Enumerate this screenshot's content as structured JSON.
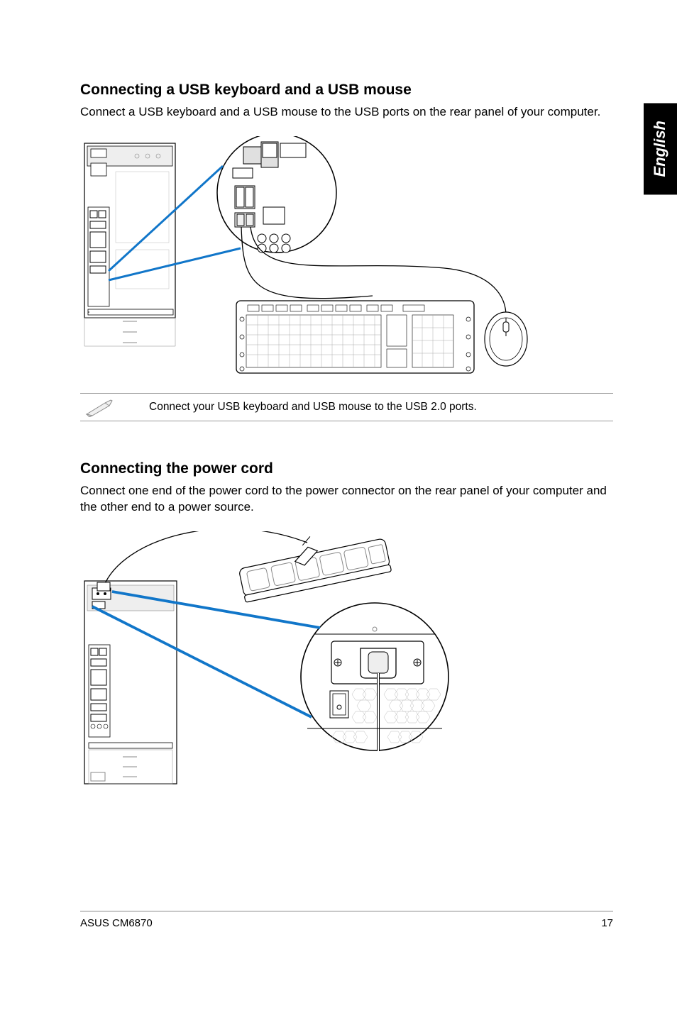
{
  "tab": {
    "label": "English"
  },
  "section1": {
    "heading": "Connecting a USB keyboard and a USB mouse",
    "body": "Connect a USB keyboard and a USB mouse to the USB ports on the rear panel of your computer."
  },
  "note": {
    "text": "Connect your USB keyboard and USB mouse to the USB 2.0 ports."
  },
  "section2": {
    "heading": "Connecting the power cord",
    "body": "Connect one end of the power cord to the power connector on the rear panel of your computer and the other end to a power source."
  },
  "footer": {
    "left": "ASUS CM6870",
    "right": "17"
  }
}
